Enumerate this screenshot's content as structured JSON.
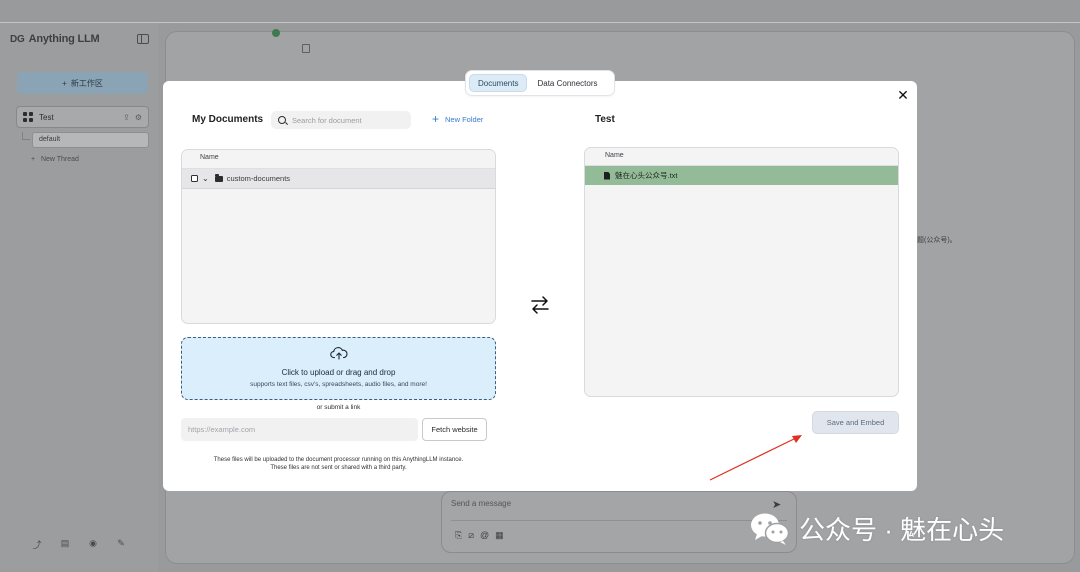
{
  "background_app": {
    "brand": "Anything LLM",
    "new_workspace_label": "新工作区",
    "workspace_name": "Test",
    "thread_default": "default",
    "new_thread_label": "New Thread",
    "right_fragment": "题(公众号)。",
    "message_placeholder": "Send a message"
  },
  "modal": {
    "tabs": [
      "Documents",
      "Data Connectors"
    ],
    "active_tab": "Documents",
    "my_documents": {
      "title": "My Documents",
      "search_placeholder": "Search for document",
      "new_folder_label": "New Folder",
      "column_header": "Name",
      "folders": [
        {
          "name": "custom-documents"
        }
      ]
    },
    "upload": {
      "title": "Click to upload or drag and drop",
      "subtitle": "supports text files, csv's, spreadsheets, audio files, and more!",
      "or_submit_link": "or submit a link",
      "url_placeholder": "https://example.com",
      "fetch_button": "Fetch website",
      "disclaimer_line1": "These files will be uploaded to the document processor running on this AnythingLLM instance.",
      "disclaimer_line2": "These files are not sent or shared with a third party."
    },
    "workspace": {
      "title": "Test",
      "column_header": "Name",
      "files": [
        {
          "name": "魅在心头公众号.txt"
        }
      ]
    },
    "save_button": "Save and Embed"
  },
  "watermark": {
    "text": "公众号 · 魅在心头"
  },
  "colors": {
    "file_row_highlight": "#94bb98",
    "upload_zone": "#dbeefb",
    "active_tab": "#dcebf6",
    "annotation_arrow": "#e0301e"
  }
}
